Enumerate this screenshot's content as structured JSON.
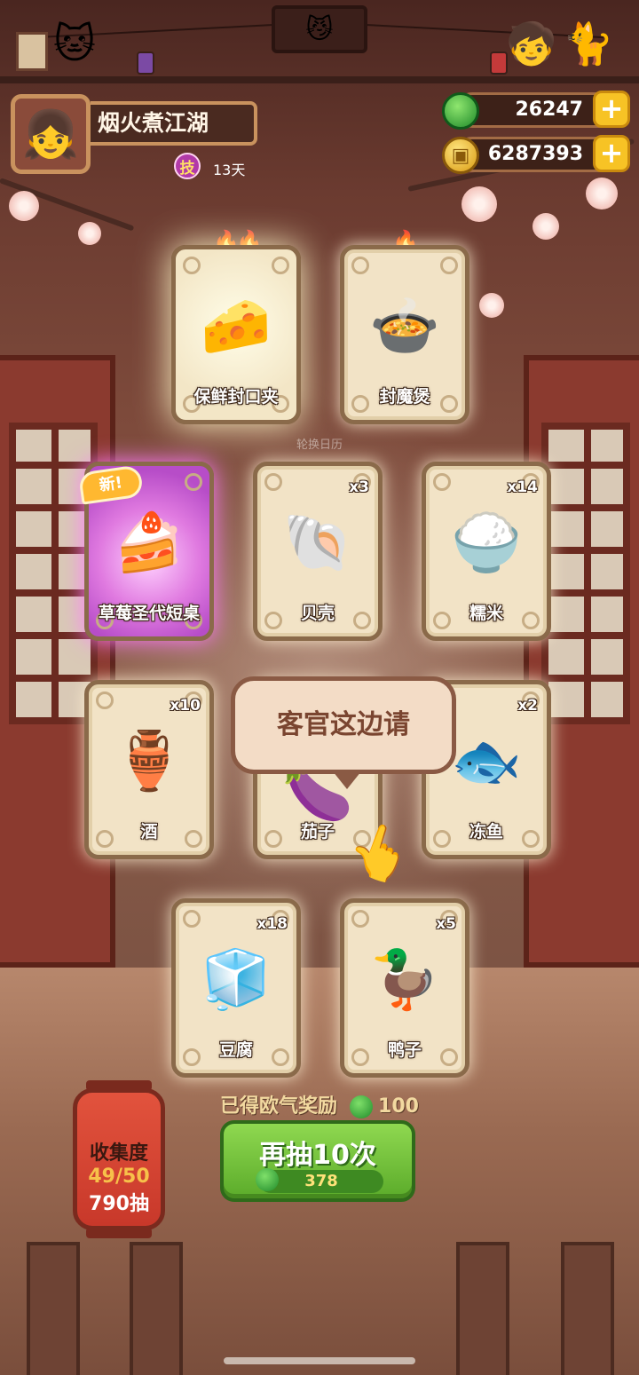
{
  "player": {
    "name": "烟火煮江湖",
    "skill_badge": "技",
    "days": "13天",
    "avatar_icon": "chef-girl-avatar"
  },
  "currency": {
    "jade": "26247",
    "coins": "6287393",
    "plus": "+"
  },
  "hint": "轮换日历",
  "cards": [
    {
      "name": "保鲜封口夹",
      "count": "",
      "icon": "clip-icon",
      "glyph": "🧀"
    },
    {
      "name": "封魔煲",
      "count": "",
      "icon": "pot-icon",
      "glyph": "🍲"
    },
    {
      "name": "草莓圣代短桌",
      "count": "",
      "icon": "table-icon",
      "glyph": "🍰"
    },
    {
      "name": "贝壳",
      "count": "x3",
      "icon": "shell-icon",
      "glyph": "🐚"
    },
    {
      "name": "糯米",
      "count": "x14",
      "icon": "rice-icon",
      "glyph": "🍚"
    },
    {
      "name": "酒",
      "count": "x10",
      "icon": "wine-jar-icon",
      "glyph": "🏺"
    },
    {
      "name": "茄子",
      "count": "",
      "icon": "eggplant-icon",
      "glyph": "🍆"
    },
    {
      "name": "冻鱼",
      "count": "x2",
      "icon": "fish-icon",
      "glyph": "🐟"
    },
    {
      "name": "豆腐",
      "count": "x18",
      "icon": "tofu-icon",
      "glyph": "🧊"
    },
    {
      "name": "鸭子",
      "count": "x5",
      "icon": "duck-icon",
      "glyph": "🦆"
    }
  ],
  "new_tag": "新!",
  "tooltip": "客官这边请",
  "reward": {
    "label": "已得欧气奖励",
    "value": "100"
  },
  "draw_button": {
    "label": "再抽10次",
    "cost": "378"
  },
  "collection": {
    "title": "收集度",
    "progress": "49/50",
    "draws": "790抽"
  }
}
